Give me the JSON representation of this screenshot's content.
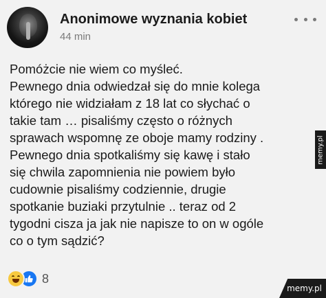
{
  "post": {
    "author": "Anonimowe wyznania kobiet",
    "time": "44 min",
    "body_lines": [
      "Pomóżcie nie wiem co myśleć.",
      "Pewnego dnia odwiedzał się do mnie kolega",
      "którego nie widziałam z 18 lat co słychać o",
      "takie tam … pisaliśmy często o różnych",
      "sprawach wspomnę ze oboje mamy rodziny .",
      "Pewnego dnia spotkaliśmy się kawę i stało",
      "się chwila zapomnienia nie powiem było",
      "cudownie pisaliśmy codziennie, drugie",
      "spotkanie buziaki przytulnie .. teraz od 2",
      "tygodni cisza ja jak nie napisze to on w ogóle",
      "co o tym sądzić?"
    ]
  },
  "reactions": {
    "icons": [
      "haha-icon",
      "like-icon"
    ],
    "count": "8"
  },
  "watermark": {
    "side": "memy.pl",
    "corner": "memy.pl"
  },
  "colors": {
    "background": "#f2f2f2",
    "like_blue": "#1877f2",
    "haha_yellow": "#f7c940"
  }
}
